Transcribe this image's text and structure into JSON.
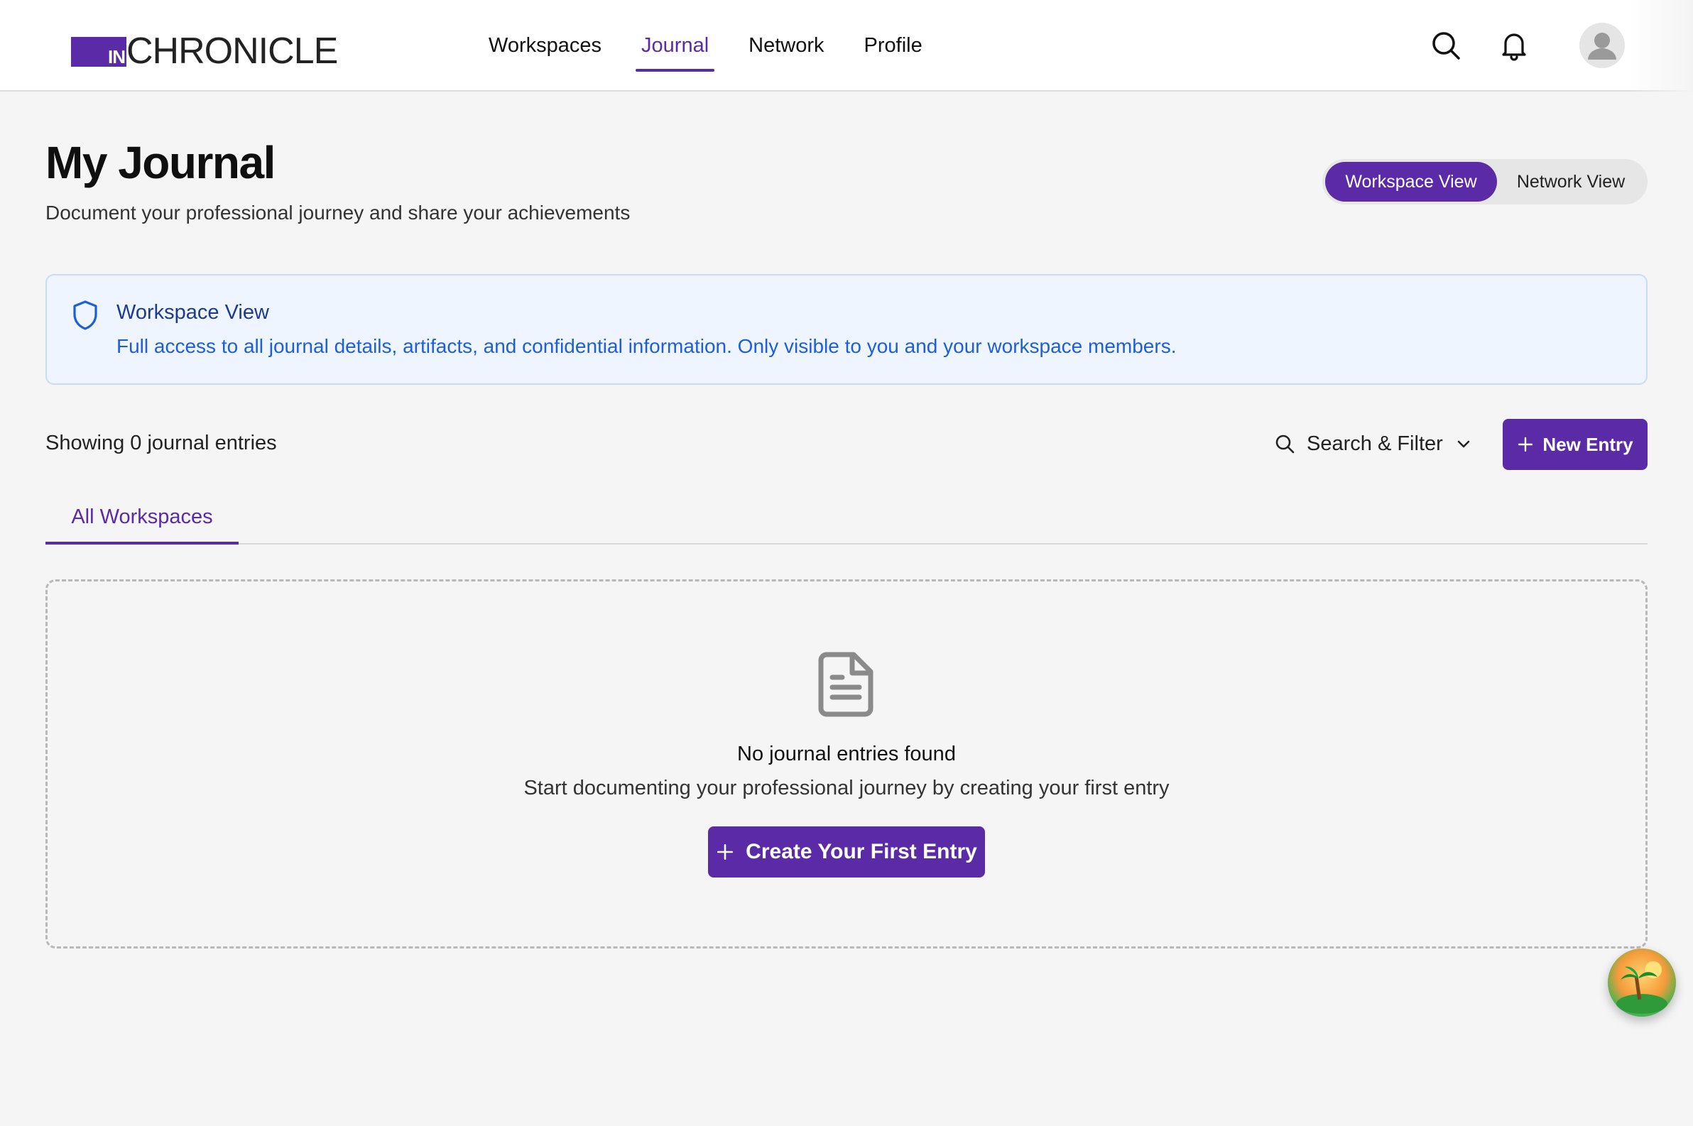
{
  "brand": {
    "prefix": "IN",
    "name": "CHRONICLE"
  },
  "nav": {
    "items": [
      {
        "label": "Workspaces",
        "active": false
      },
      {
        "label": "Journal",
        "active": true
      },
      {
        "label": "Network",
        "active": false
      },
      {
        "label": "Profile",
        "active": false
      }
    ],
    "icons": [
      "search-icon",
      "bell-icon",
      "avatar"
    ]
  },
  "header": {
    "title": "My Journal",
    "subtitle": "Document your professional journey and share your achievements"
  },
  "view_toggle": {
    "workspace_label": "Workspace View",
    "network_label": "Network View",
    "selected": "Workspace View"
  },
  "banner": {
    "title": "Workspace View",
    "text": "Full access to all journal details, artifacts, and confidential information. Only visible to you and your workspace members."
  },
  "toolbar": {
    "count_text": "Showing 0 journal entries",
    "filter_label": "Search & Filter",
    "new_entry_label": "New Entry"
  },
  "tabs": [
    {
      "label": "All Workspaces",
      "active": true
    }
  ],
  "empty_state": {
    "title": "No journal entries found",
    "text": "Start documenting your professional journey by creating your first entry",
    "button_label": "Create Your First Entry"
  },
  "colors": {
    "accent": "#5b2aa6",
    "banner_bg": "#eef5ff",
    "banner_text": "#1f5fd6",
    "page_bg": "#f5f5f5"
  }
}
